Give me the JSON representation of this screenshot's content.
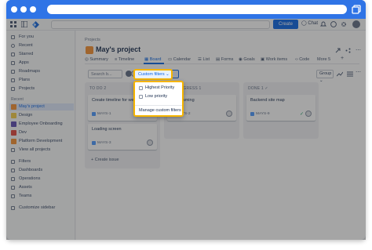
{
  "topnav": {
    "search_placeholder": "",
    "create_label": "Create",
    "chat_label": "Chat"
  },
  "sidebar": {
    "items": [
      {
        "label": "For you"
      },
      {
        "label": "Recent"
      },
      {
        "label": "Starred"
      },
      {
        "label": "Apps"
      },
      {
        "label": "Roadmaps"
      },
      {
        "label": "Plans"
      },
      {
        "label": "Projects"
      }
    ],
    "recent_label": "Recent",
    "projects": [
      {
        "label": "May's project",
        "color": "#f79232"
      },
      {
        "label": "Design",
        "color": "#f5cd47"
      },
      {
        "label": "Employee Onboarding",
        "color": "#5e4db2"
      },
      {
        "label": "Dev",
        "color": "#e2483d"
      },
      {
        "label": "Platform Development",
        "color": "#f79232"
      }
    ],
    "view_all": "View all projects",
    "bottom": [
      {
        "label": "Filters"
      },
      {
        "label": "Dashboards"
      },
      {
        "label": "Operations"
      },
      {
        "label": "Assets"
      },
      {
        "label": "Teams"
      }
    ],
    "customize": "Customize sidebar"
  },
  "main": {
    "breadcrumb": "Projects",
    "title": "May's project",
    "tabs": [
      {
        "label": "Summary"
      },
      {
        "label": "Timeline"
      },
      {
        "label": "Board"
      },
      {
        "label": "Calendar"
      },
      {
        "label": "List"
      },
      {
        "label": "Forms"
      },
      {
        "label": "Goals"
      },
      {
        "label": "Work items"
      },
      {
        "label": "Code"
      },
      {
        "label": "More"
      }
    ],
    "more_count": "5",
    "search_placeholder": "Search b...",
    "filter_button": "Custom filters",
    "group_button": "Group"
  },
  "columns": [
    {
      "title": "TO DO",
      "count": "2",
      "cards": [
        {
          "title": "Create timeline for website",
          "key": "MAYS-1"
        },
        {
          "title": "Loading screen",
          "key": "MAYS-3"
        }
      ],
      "create_label": "+ Create issue"
    },
    {
      "title": "IN PROGRESS",
      "count": "1",
      "cards": [
        {
          "title": "Wireframing",
          "key": "MAYS-2"
        }
      ]
    },
    {
      "title": "DONE",
      "count": "1",
      "cards": [
        {
          "title": "Backend site map",
          "key": "MAYS-9"
        }
      ]
    }
  ],
  "dropdown": {
    "options": [
      {
        "label": "Highest Priority"
      },
      {
        "label": "Low priority"
      }
    ],
    "manage_label": "Manage custom filters"
  }
}
